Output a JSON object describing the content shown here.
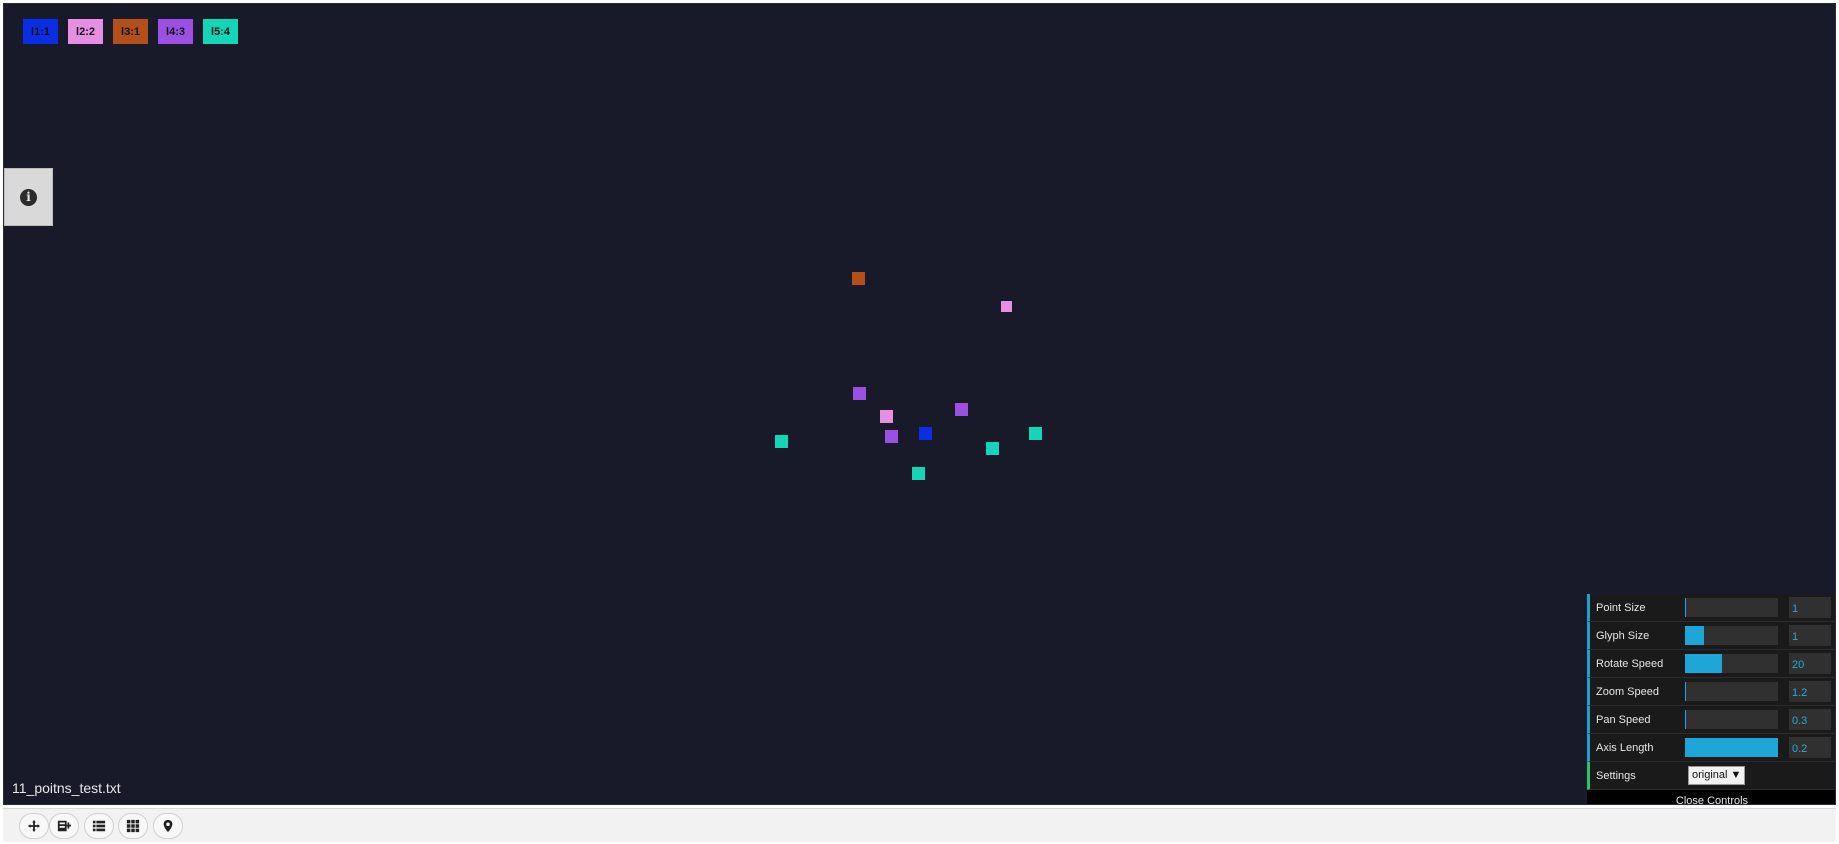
{
  "legend": [
    {
      "label": "l1:1",
      "color": "#0a2ee6"
    },
    {
      "label": "l2:2",
      "color": "#e78ee4"
    },
    {
      "label": "l3:1",
      "color": "#b34f1b"
    },
    {
      "label": "l4:3",
      "color": "#9c4fe3"
    },
    {
      "label": "l5:4",
      "color": "#12d6b5"
    }
  ],
  "info_icon": "info-icon",
  "filename": "11_poitns_test.txt",
  "controls": {
    "rows": [
      {
        "label": "Point Size",
        "value": "1",
        "fill_fraction": 0.01
      },
      {
        "label": "Glyph Size",
        "value": "1",
        "fill_fraction": 0.2
      },
      {
        "label": "Rotate Speed",
        "value": "20",
        "fill_fraction": 0.4
      },
      {
        "label": "Zoom Speed",
        "value": "1.2",
        "fill_fraction": 0.01
      },
      {
        "label": "Pan Speed",
        "value": "0.3",
        "fill_fraction": 0.01
      },
      {
        "label": "Axis Length",
        "value": "0.2",
        "fill_fraction": 1.0
      }
    ],
    "settings_label": "Settings",
    "settings_value": "original ▼",
    "close_label": "Close Controls"
  },
  "toolbar": {
    "tools": [
      "move-icon",
      "add-layer-icon",
      "list-icon",
      "grid-icon",
      "map-pin-icon"
    ]
  }
}
